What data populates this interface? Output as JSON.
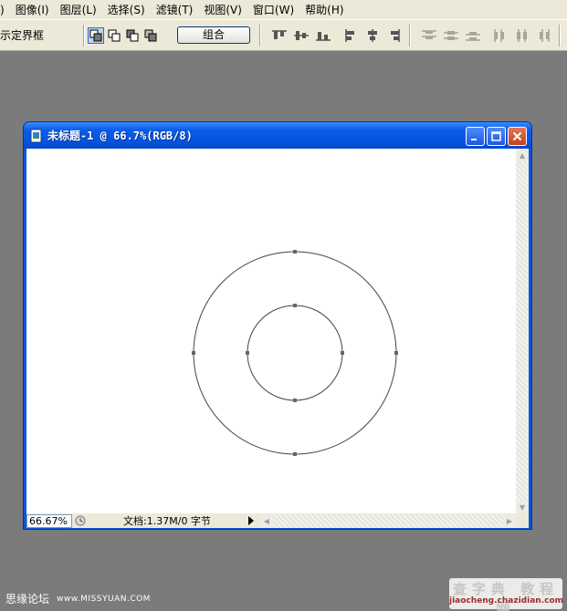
{
  "menubar": {
    "items": [
      {
        "label": ")",
        "key": ""
      },
      {
        "label": "图像(I)",
        "key": "I"
      },
      {
        "label": "图层(L)",
        "key": "L"
      },
      {
        "label": "选择(S)",
        "key": "S"
      },
      {
        "label": "滤镜(T)",
        "key": "T"
      },
      {
        "label": "视图(V)",
        "key": "V"
      },
      {
        "label": "窗口(W)",
        "key": "W"
      },
      {
        "label": "帮助(H)",
        "key": "H"
      }
    ]
  },
  "options": {
    "show_bounds_label": "示定界框",
    "combine_label": "组合"
  },
  "document": {
    "title": "未标题-1 @ 66.7%(RGB/8)",
    "zoom": "66.67%",
    "info": "文档:1.37M/0 字节"
  },
  "watermarks": {
    "left_cn": "思缘论坛",
    "left_url": "www.MISSYUAN.COM",
    "right_big": "查字典 教程网",
    "right_small": "jiaocheng.chazidian.com"
  },
  "colors": {
    "titlebar": "#0a5ce8",
    "workspace": "#7b7b7b",
    "toolbar": "#ece9d8",
    "close_button": "#c4411c"
  },
  "icons": [
    "photoshop-doc-icon",
    "minimize-icon",
    "maximize-icon",
    "close-icon",
    "status-menu-icon",
    "arrow-right-icon"
  ]
}
